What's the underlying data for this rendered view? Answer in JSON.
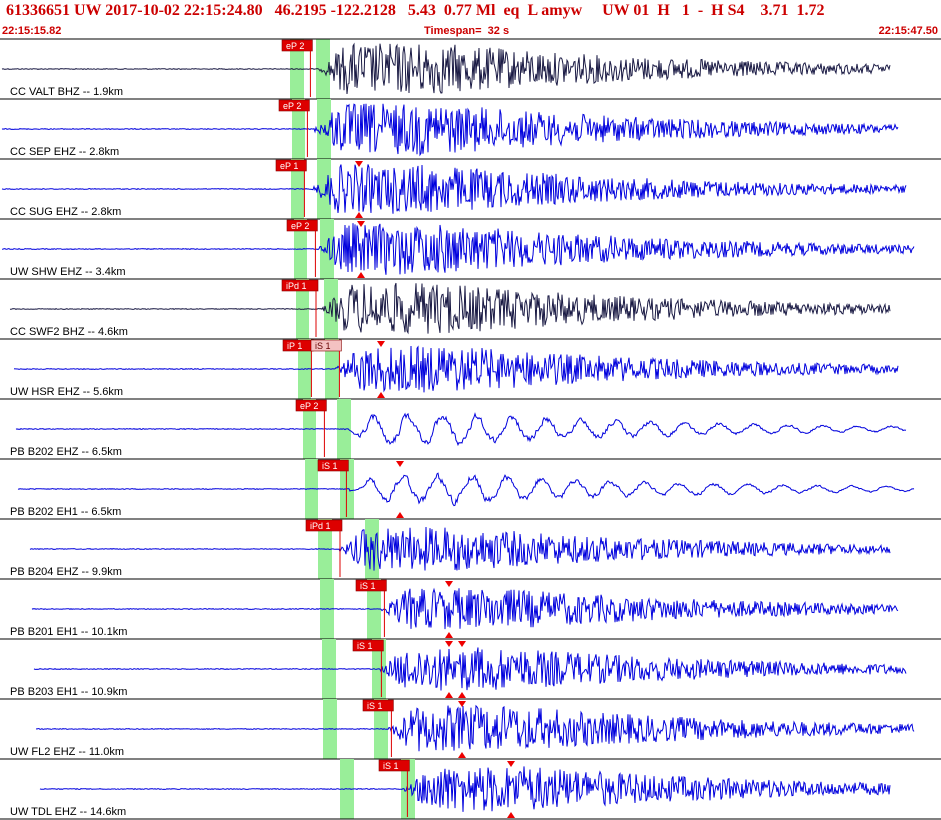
{
  "header": {
    "title": "61336651 UW 2017-10-02 22:15:24.80   46.2195 -122.2128   5.43  0.77 Ml  eq  L amyw     UW 01  H   1  -  H S4    3.71  1.72",
    "start_time": "22:15:15.82",
    "timespan": "Timespan=  32 s",
    "end_time": "22:15:47.50"
  },
  "colors": {
    "background": "#ffffff",
    "header_text": "#cc0000",
    "trace_blue": "#0000dd",
    "trace_dark": "#1a1a44",
    "pick_fill": "#dd0000",
    "pick_text": "#ffffff",
    "window_green": "#99ee99",
    "arrival_marker": "#ee0000",
    "separator": "#000000"
  },
  "traces": [
    {
      "label": "CC VALT BHZ -- 1.9km",
      "color": "dark",
      "picks": [
        {
          "label": "eP 2"
        }
      ]
    },
    {
      "label": "CC SEP EHZ -- 2.8km",
      "color": "blue",
      "picks": [
        {
          "label": "eP 2"
        }
      ]
    },
    {
      "label": "CC SUG EHZ -- 2.8km",
      "color": "blue",
      "picks": [
        {
          "label": "eP 1"
        }
      ]
    },
    {
      "label": "UW SHW EHZ -- 3.4km",
      "color": "blue",
      "picks": [
        {
          "label": "eP 2"
        }
      ]
    },
    {
      "label": "CC SWF2 BHZ -- 4.6km",
      "color": "dark",
      "picks": [
        {
          "label": "iPd 1"
        }
      ]
    },
    {
      "label": "UW HSR EHZ -- 5.6km",
      "color": "blue",
      "picks": [
        {
          "label": "iP 1"
        },
        {
          "label": "iS 1"
        }
      ]
    },
    {
      "label": "PB B202 EHZ -- 6.5km",
      "color": "blue",
      "picks": [
        {
          "label": "eP 2"
        }
      ]
    },
    {
      "label": "PB B202 EH1 -- 6.5km",
      "color": "blue",
      "picks": [
        {
          "label": "iS 1"
        }
      ]
    },
    {
      "label": "PB B204 EHZ -- 9.9km",
      "color": "blue",
      "picks": [
        {
          "label": "iPd 1"
        }
      ]
    },
    {
      "label": "PB B201 EH1 -- 10.1km",
      "color": "blue",
      "picks": [
        {
          "label": "iS 1"
        }
      ]
    },
    {
      "label": "PB B203 EH1 -- 10.9km",
      "color": "blue",
      "picks": [
        {
          "label": "iS 1"
        }
      ]
    },
    {
      "label": "UW FL2 EHZ -- 11.0km",
      "color": "blue",
      "picks": [
        {
          "label": "iS 1"
        }
      ]
    },
    {
      "label": "UW TDL EHZ -- 14.6km",
      "color": "blue",
      "picks": [
        {
          "label": "iS 1"
        }
      ]
    }
  ]
}
